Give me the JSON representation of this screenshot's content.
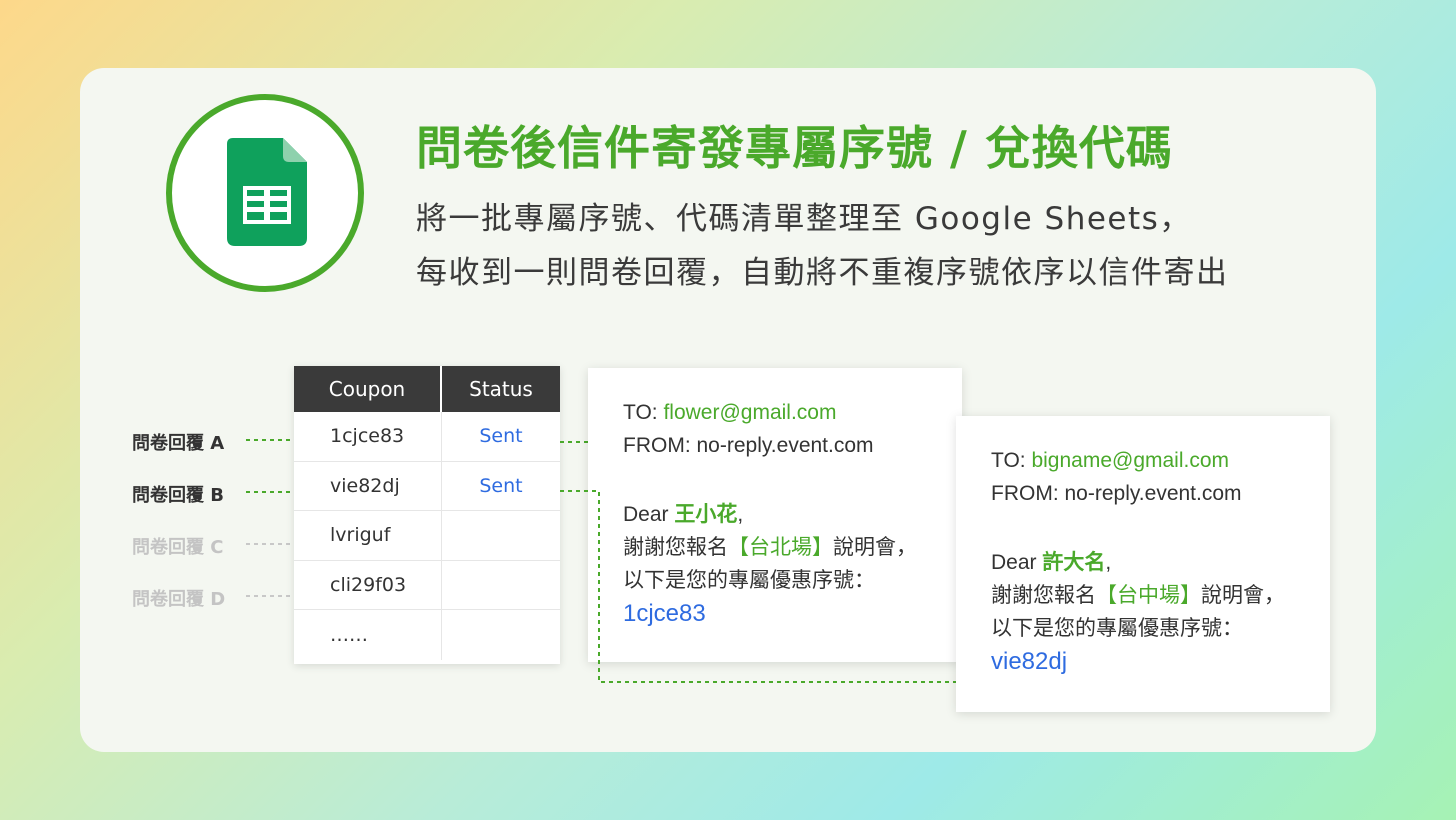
{
  "header": {
    "title": "問卷後信件寄發專屬序號 / 兌換代碼",
    "subtitle_line1": "將一批專屬序號、代碼清單整理至 Google Sheets，",
    "subtitle_line2": "每收到一則問卷回覆，自動將不重複序號依序以信件寄出"
  },
  "logo": {
    "icon": "google-sheets-icon",
    "color": "#4aa92b"
  },
  "responses": [
    {
      "label": "問卷回覆 A",
      "active": true
    },
    {
      "label": "問卷回覆 B",
      "active": true
    },
    {
      "label": "問卷回覆 C",
      "active": false
    },
    {
      "label": "問卷回覆 D",
      "active": false
    }
  ],
  "table": {
    "headers": [
      "Coupon",
      "Status"
    ],
    "rows": [
      [
        "1cjce83",
        "Sent"
      ],
      [
        "vie82dj",
        "Sent"
      ],
      [
        "lvriguf",
        ""
      ],
      [
        "cli29f03",
        ""
      ],
      [
        "……",
        ""
      ]
    ]
  },
  "emails": [
    {
      "to_label": "TO: ",
      "to": "flower@gmail.com",
      "from": "FROM: no-reply.event.com",
      "dear": "Dear ",
      "name": "王小花",
      "comma": ",",
      "thanks_pre": "謝謝您報名",
      "venue": "【台北場】",
      "thanks_post": "說明會，",
      "intro": "以下是您的專屬優惠序號：",
      "code": "1cjce83"
    },
    {
      "to_label": "TO: ",
      "to": "bigname@gmail.com",
      "from": "FROM: no-reply.event.com",
      "dear": "Dear ",
      "name": "許大名",
      "comma": ",",
      "thanks_pre": "謝謝您報名",
      "venue": "【台中場】",
      "thanks_post": "說明會，",
      "intro": "以下是您的專屬優惠序號：",
      "code": "vie82dj"
    }
  ],
  "colors": {
    "accent": "#4aa92b",
    "link": "#2e6be0",
    "header_bg": "#3a3a3a"
  }
}
